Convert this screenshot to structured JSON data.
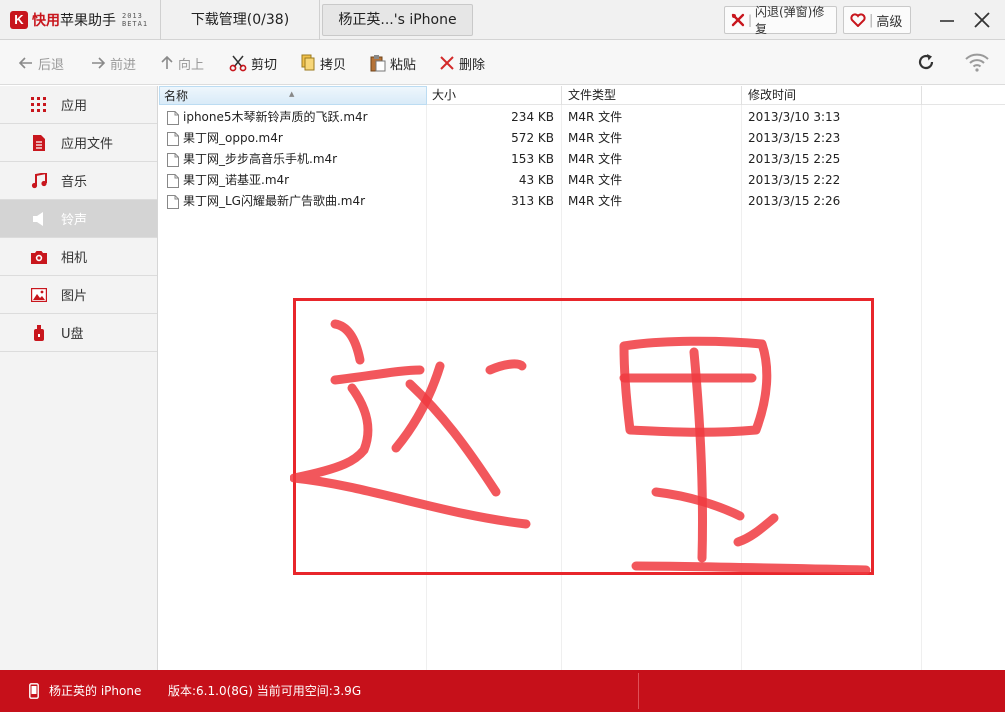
{
  "app": {
    "logo_letter": "K",
    "name_red": "快用",
    "name_rest": "苹果助手",
    "version_line1": "2013",
    "version_line2": "BETA1"
  },
  "tabs": {
    "download": "下载管理(0/38)",
    "device": "杨正英...'s iPhone"
  },
  "titlebar": {
    "fix_label": "闪退(弹窗)修复",
    "advanced_label": "高级"
  },
  "toolbar": {
    "back": "后退",
    "forward": "前进",
    "up": "向上",
    "cut": "剪切",
    "copy": "拷贝",
    "paste": "粘贴",
    "delete": "删除"
  },
  "sidebar": {
    "items": [
      {
        "label": "应用",
        "icon": "grid-icon"
      },
      {
        "label": "应用文件",
        "icon": "document-icon"
      },
      {
        "label": "音乐",
        "icon": "music-note-icon"
      },
      {
        "label": "铃声",
        "icon": "speaker-icon",
        "active": true
      },
      {
        "label": "相机",
        "icon": "camera-icon"
      },
      {
        "label": "图片",
        "icon": "image-icon"
      },
      {
        "label": "U盘",
        "icon": "usb-drive-icon"
      }
    ]
  },
  "table": {
    "columns": [
      "名称",
      "大小",
      "文件类型",
      "修改时间"
    ],
    "rows": [
      {
        "name": "iphone5木琴新铃声质的飞跃.m4r",
        "size": "234 KB",
        "type": "M4R 文件",
        "modified": "2013/3/10 3:13"
      },
      {
        "name": "果丁网_oppo.m4r",
        "size": "572 KB",
        "type": "M4R 文件",
        "modified": "2013/3/15 2:23"
      },
      {
        "name": "果丁网_步步高音乐手机.m4r",
        "size": "153 KB",
        "type": "M4R 文件",
        "modified": "2013/3/15 2:25"
      },
      {
        "name": "果丁网_诺基亚.m4r",
        "size": "43 KB",
        "type": "M4R 文件",
        "modified": "2013/3/15 2:22"
      },
      {
        "name": "果丁网_LG闪耀最新广告歌曲.m4r",
        "size": "313 KB",
        "type": "M4R 文件",
        "modified": "2013/3/15 2:26"
      }
    ]
  },
  "annotation": {
    "handwritten_text": "这里",
    "color": "#e8262b"
  },
  "statusbar": {
    "device_name": "杨正英的 iPhone",
    "info": "版本:6.1.0(8G) 当前可用空间:3.9G"
  },
  "colors": {
    "brand_red": "#c6101a",
    "sidebar_active": "#d4d4d4"
  }
}
